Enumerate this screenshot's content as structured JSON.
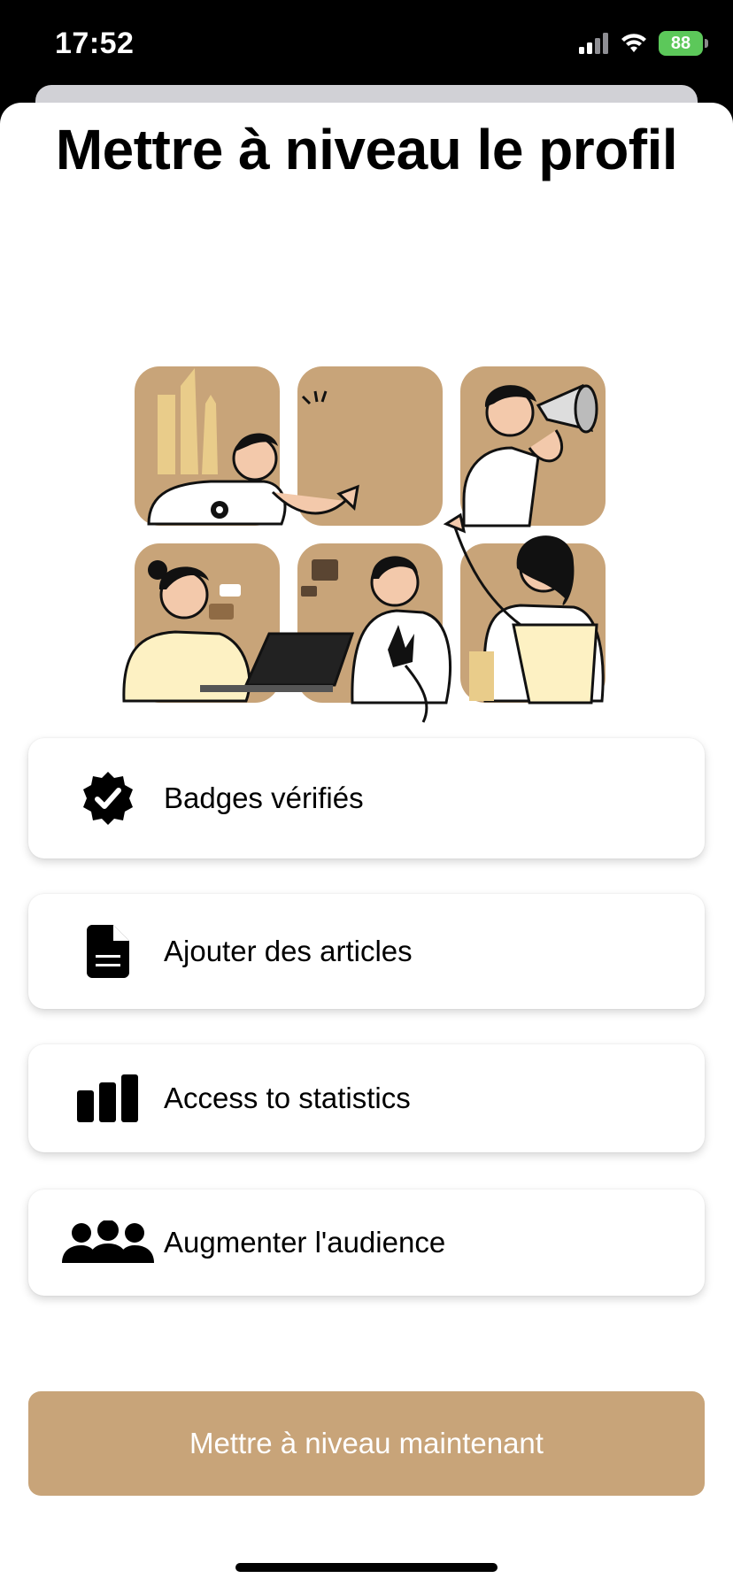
{
  "status_bar": {
    "time": "17:52",
    "battery": "88",
    "icons": [
      "signal-icon",
      "wifi-icon",
      "battery-charging-icon"
    ]
  },
  "header": {
    "title": "Mettre à niveau le profil"
  },
  "illustration": {
    "icon": "team-collaboration-illustration"
  },
  "features": [
    {
      "icon": "verified-badge-icon",
      "label": "Badges vérifiés"
    },
    {
      "icon": "document-icon",
      "label": "Ajouter des articles"
    },
    {
      "icon": "bar-chart-icon",
      "label": "Access to statistics"
    },
    {
      "icon": "group-icon",
      "label": "Augmenter l'audience"
    }
  ],
  "cta": {
    "label": "Mettre à niveau maintenant"
  },
  "colors": {
    "accent": "#c8a479",
    "illustration_tile": "#c8a479",
    "battery": "#5cc85a"
  }
}
